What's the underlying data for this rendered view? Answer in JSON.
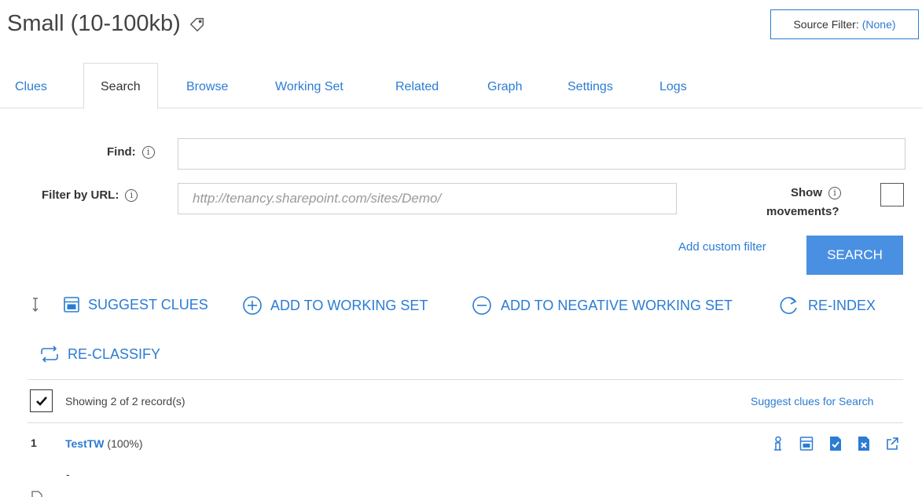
{
  "header": {
    "title": "Small (10-100kb)",
    "source_filter_label": "Source Filter:",
    "source_filter_value": "(None)"
  },
  "tabs": [
    {
      "label": "Clues",
      "active": false
    },
    {
      "label": "Search",
      "active": true
    },
    {
      "label": "Browse",
      "active": false
    },
    {
      "label": "Working Set",
      "active": false
    },
    {
      "label": "Related",
      "active": false
    },
    {
      "label": "Graph",
      "active": false
    },
    {
      "label": "Settings",
      "active": false
    },
    {
      "label": "Logs",
      "active": false
    }
  ],
  "form": {
    "find_label": "Find:",
    "find_value": "",
    "filter_url_label": "Filter by URL:",
    "filter_url_placeholder": "http://tenancy.sharepoint.com/sites/Demo/",
    "show_movements_line1": "Show",
    "show_movements_line2": "movements?",
    "show_movements_checked": false,
    "add_custom_filter": "Add custom filter",
    "search_button": "SEARCH"
  },
  "actions": {
    "suggest_clues": "SUGGEST CLUES",
    "add_to_working_set": "ADD TO WORKING SET",
    "add_to_negative_working_set": "ADD TO NEGATIVE WORKING SET",
    "re_index": "RE-INDEX",
    "re_classify": "RE-CLASSIFY"
  },
  "results": {
    "select_all_checked": true,
    "showing_text": "Showing 2 of 2 record(s)",
    "suggest_clues_link": "Suggest clues for Search",
    "rows": [
      {
        "index": "1",
        "name": "TestTW",
        "score": "(100%)",
        "snippet": "-",
        "icons": [
          "info-person-icon",
          "calculator-icon",
          "doc-check-icon",
          "doc-x-icon",
          "external-link-icon"
        ]
      }
    ]
  },
  "colors": {
    "accent": "#2b7cd3",
    "button": "#4a90e2",
    "border": "#dddddd"
  }
}
